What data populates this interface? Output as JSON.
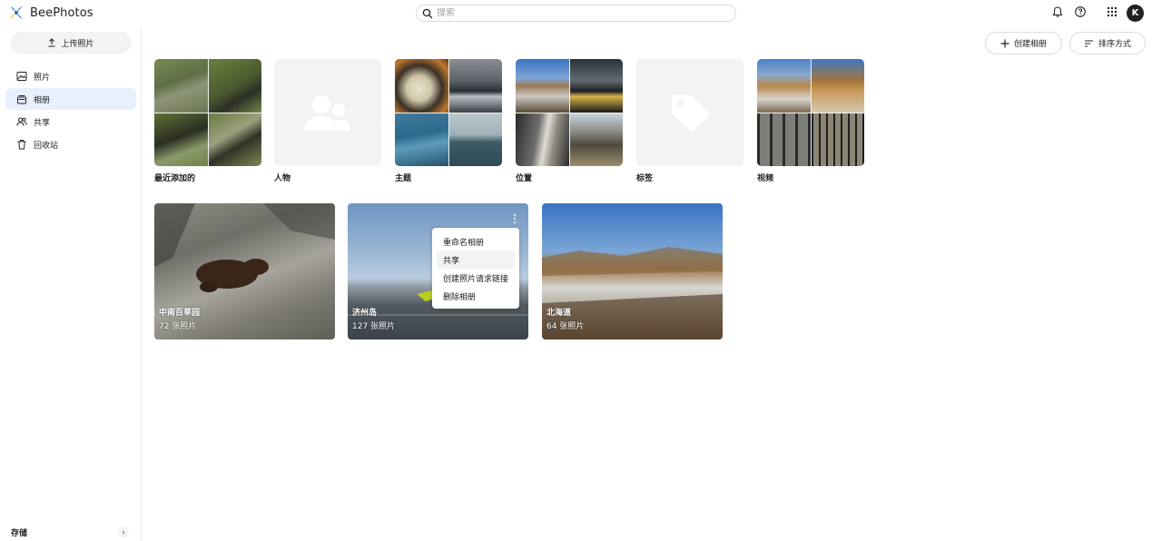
{
  "app": {
    "name": "BeePhotos",
    "user_initial": "K"
  },
  "search": {
    "placeholder": "搜索"
  },
  "header": {
    "icons": [
      "bell-icon",
      "help-icon",
      "apps-grid-icon"
    ]
  },
  "sidebar": {
    "upload_label": "上传照片",
    "items": [
      {
        "label": "照片",
        "icon": "image-icon",
        "active": false
      },
      {
        "label": "相册",
        "icon": "album-icon",
        "active": true
      },
      {
        "label": "共享",
        "icon": "people-icon",
        "active": false
      },
      {
        "label": "回收站",
        "icon": "trash-icon",
        "active": false
      }
    ],
    "storage_label": "存储"
  },
  "toolbar": {
    "create_album_label": "创建相册",
    "sort_label": "排序方式"
  },
  "categories": [
    {
      "label": "最近添加的"
    },
    {
      "label": "人物"
    },
    {
      "label": "主题"
    },
    {
      "label": "位置"
    },
    {
      "label": "标签"
    },
    {
      "label": "视频"
    }
  ],
  "albums": [
    {
      "name": "中南百草园",
      "count": "72 张照片"
    },
    {
      "name": "济州岛",
      "count": "127 张照片"
    },
    {
      "name": "北海道",
      "count": "64 张照片"
    }
  ],
  "context_menu": {
    "items": [
      "重命名相册",
      "共享",
      "创建照片请求链接",
      "删除相册"
    ],
    "highlighted": "共享"
  },
  "colors": {
    "accent": "#e8f0fe",
    "avatar_bg": "#202124",
    "logo_blue": "#1a73e8",
    "logo_yellow": "#fbbc04"
  }
}
